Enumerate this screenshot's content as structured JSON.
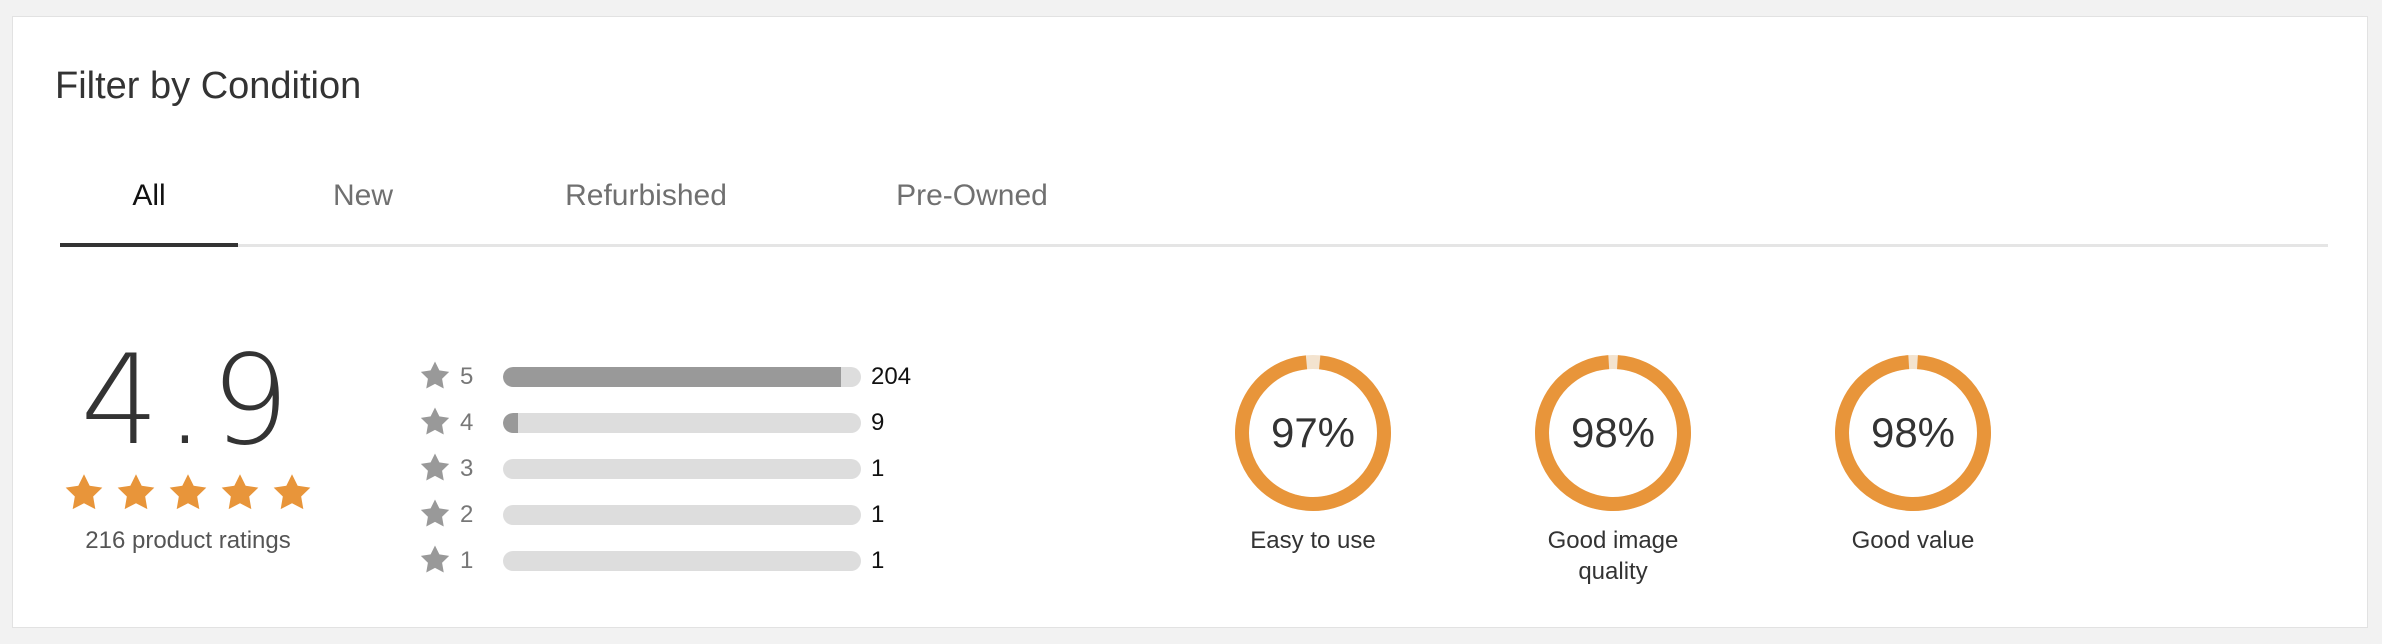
{
  "heading": "Filter by Condition",
  "tabs": [
    {
      "label": "All",
      "active": true
    },
    {
      "label": "New",
      "active": false
    },
    {
      "label": "Refurbished",
      "active": false
    },
    {
      "label": "Pre-Owned",
      "active": false
    }
  ],
  "overall": {
    "score": "4.9",
    "stars": 5,
    "ratings_label": "216 product ratings"
  },
  "distribution": [
    {
      "stars": "5",
      "count": "204",
      "fraction": 0.944
    },
    {
      "stars": "4",
      "count": "9",
      "fraction": 0.042
    },
    {
      "stars": "3",
      "count": "1",
      "fraction": 0.0
    },
    {
      "stars": "2",
      "count": "1",
      "fraction": 0.0
    },
    {
      "stars": "1",
      "count": "1",
      "fraction": 0.0
    }
  ],
  "aspects": [
    {
      "value": "97%",
      "percent": 97,
      "label": "Easy to use"
    },
    {
      "value": "98%",
      "percent": 98,
      "label": "Good image quality"
    },
    {
      "value": "98%",
      "percent": 98,
      "label": "Good value"
    }
  ],
  "colors": {
    "accent": "#e8953a",
    "ring_gap": "#f3e3cf",
    "bar_fill": "#999999",
    "bar_track": "#dddddd",
    "star_gray": "#999999"
  },
  "icons": {
    "star": "star-icon"
  }
}
